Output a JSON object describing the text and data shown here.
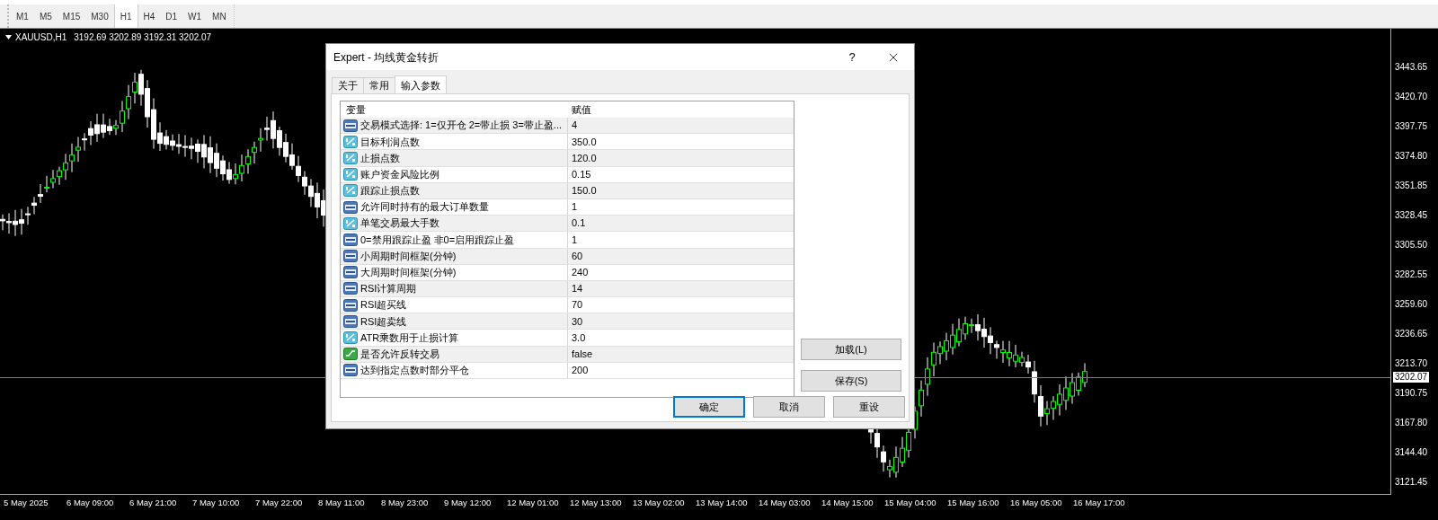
{
  "toolbar": {
    "timeframes": [
      {
        "label": "M1",
        "selected": false
      },
      {
        "label": "M5",
        "selected": false
      },
      {
        "label": "M15",
        "selected": false
      },
      {
        "label": "M30",
        "selected": false
      },
      {
        "label": "H1",
        "selected": true
      },
      {
        "label": "H4",
        "selected": false
      },
      {
        "label": "D1",
        "selected": false
      },
      {
        "label": "W1",
        "selected": false
      },
      {
        "label": "MN",
        "selected": false
      }
    ]
  },
  "chart": {
    "symbol": "XAUUSD,H1",
    "quote": "3192.69 3202.89 3192.31 3202.07",
    "current_price": "3202.07",
    "price_axis": [
      "3443.65",
      "3420.70",
      "3397.75",
      "3374.80",
      "3351.85",
      "3328.45",
      "3305.50",
      "3282.55",
      "3259.60",
      "3236.65",
      "3213.70",
      "3190.75",
      "3167.80",
      "3144.40",
      "3121.45"
    ],
    "time_axis": [
      "5 May 2025",
      "6 May 09:00",
      "6 May 21:00",
      "7 May 10:00",
      "7 May 22:00",
      "8 May 11:00",
      "8 May 23:00",
      "9 May 12:00",
      "12 May 01:00",
      "12 May 13:00",
      "13 May 02:00",
      "13 May 14:00",
      "14 May 03:00",
      "14 May 15:00",
      "15 May 04:00",
      "15 May 16:00",
      "16 May 05:00",
      "16 May 17:00"
    ]
  },
  "dialog": {
    "title": "Expert - 均线黄金转折",
    "help": "?",
    "tabs": [
      {
        "label": "关于",
        "selected": false
      },
      {
        "label": "常用",
        "selected": false
      },
      {
        "label": "输入参数",
        "selected": true
      }
    ],
    "columns": [
      "变量",
      "赋值"
    ],
    "rows": [
      {
        "kind": "int",
        "name": "交易模式选择: 1=仅开仓 2=带止损 3=带止盈...",
        "value": "4"
      },
      {
        "kind": "double",
        "name": "目标利润点数",
        "value": "350.0"
      },
      {
        "kind": "double",
        "name": "止损点数",
        "value": "120.0"
      },
      {
        "kind": "double",
        "name": "账户资金风险比例",
        "value": "0.15"
      },
      {
        "kind": "double",
        "name": "跟踪止损点数",
        "value": "150.0"
      },
      {
        "kind": "int",
        "name": "允许同时持有的最大订单数量",
        "value": "1"
      },
      {
        "kind": "double",
        "name": "单笔交易最大手数",
        "value": "0.1"
      },
      {
        "kind": "int",
        "name": "0=禁用跟踪止盈 非0=启用跟踪止盈",
        "value": "1"
      },
      {
        "kind": "int",
        "name": "小周期时间框架(分钟)",
        "value": "60"
      },
      {
        "kind": "int",
        "name": "大周期时间框架(分钟)",
        "value": "240"
      },
      {
        "kind": "int",
        "name": "RSI计算周期",
        "value": "14"
      },
      {
        "kind": "int",
        "name": "RSI超买线",
        "value": "70"
      },
      {
        "kind": "int",
        "name": "RSI超卖线",
        "value": "30"
      },
      {
        "kind": "double",
        "name": "ATR乘数用于止损计算",
        "value": "3.0"
      },
      {
        "kind": "bool",
        "name": "是否允许反转交易",
        "value": "false"
      },
      {
        "kind": "int",
        "name": "达到指定点数时部分平仓",
        "value": "200"
      }
    ],
    "side_buttons": [
      "加载(L)",
      "保存(S)"
    ],
    "buttons": [
      {
        "label": "确定",
        "default": true
      },
      {
        "label": "取消",
        "default": false
      },
      {
        "label": "重设",
        "default": false
      }
    ]
  }
}
